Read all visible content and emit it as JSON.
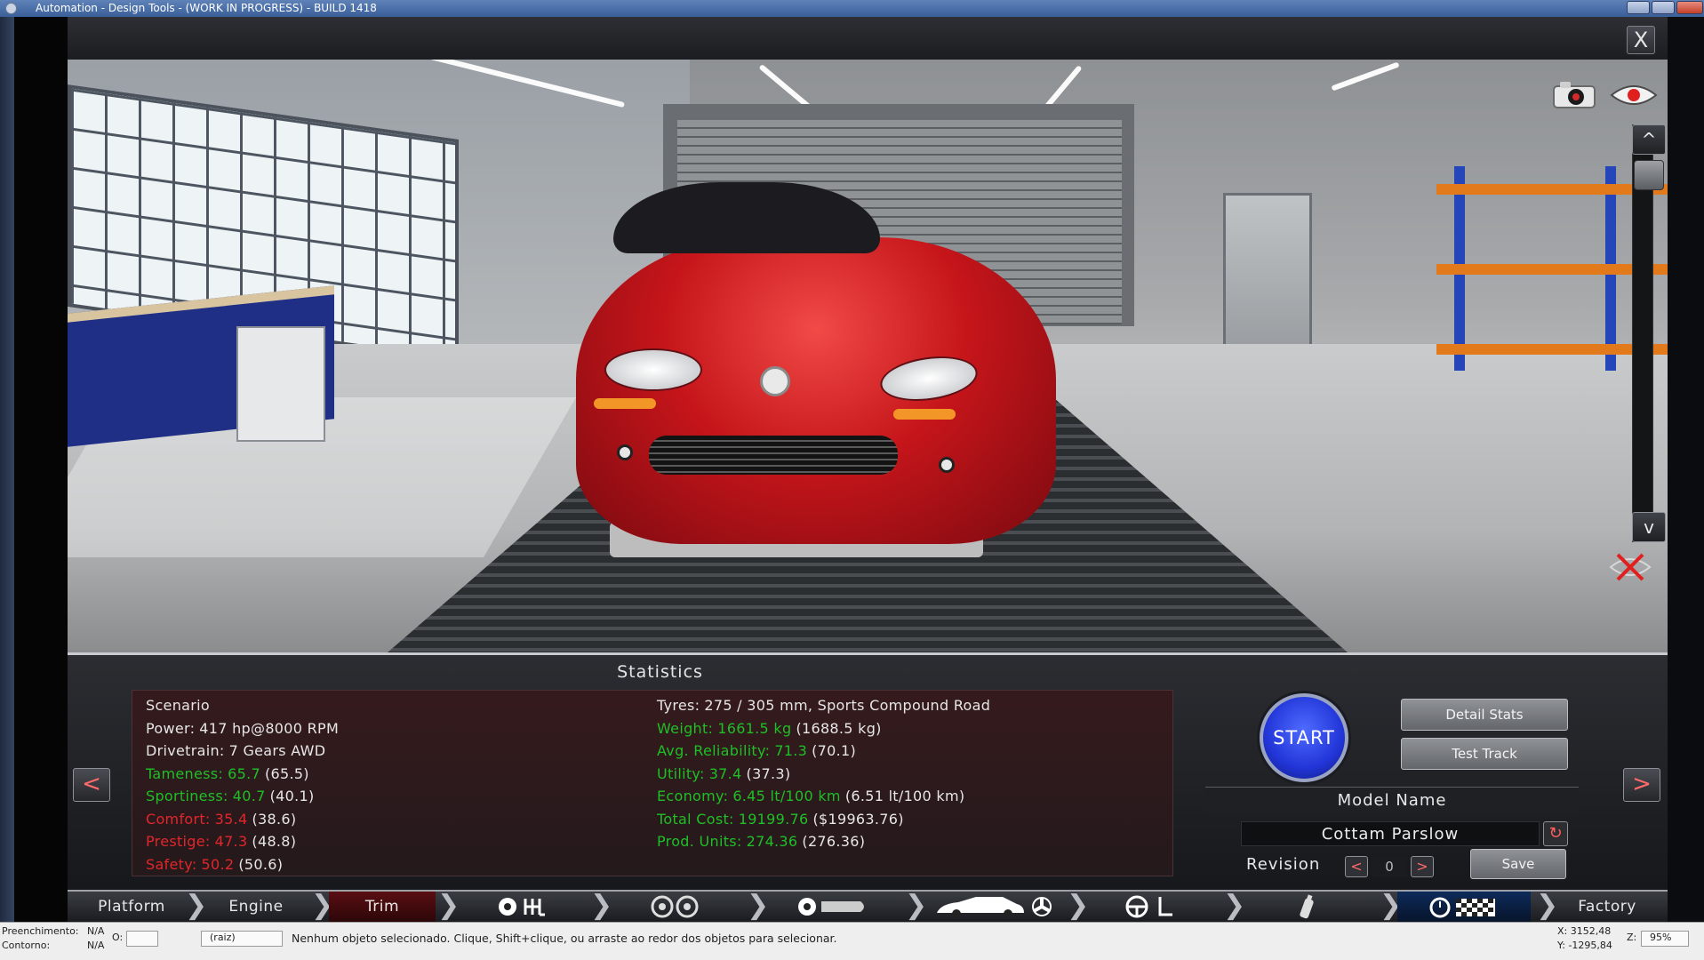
{
  "window": {
    "title": "Automation - Design Tools - (WORK IN PROGRESS) - BUILD 1418"
  },
  "viewport": {
    "close_label": "X",
    "scroll_up_label": "^",
    "scroll_down_label": "v"
  },
  "statistics": {
    "title": "Statistics",
    "left": [
      {
        "label": "Scenario",
        "value": "",
        "extra": "",
        "color": "#e6e6e6"
      },
      {
        "label": "Power:",
        "value": "417 hp@8000 RPM",
        "extra": "",
        "color": "#e6e6e6"
      },
      {
        "label": "Drivetrain:",
        "value": "7 Gears AWD",
        "extra": "",
        "color": "#e6e6e6"
      },
      {
        "label": "Tameness:",
        "value": "65.7",
        "extra": "(65.5)",
        "color": "#1fbf27"
      },
      {
        "label": "Sportiness:",
        "value": "40.7",
        "extra": "(40.1)",
        "color": "#1fbf27"
      },
      {
        "label": "Comfort:",
        "value": "35.4",
        "extra": "(38.6)",
        "color": "#e2262b"
      },
      {
        "label": "Prestige:",
        "value": "47.3",
        "extra": "(48.8)",
        "color": "#e2262b"
      },
      {
        "label": "Safety:",
        "value": "50.2",
        "extra": "(50.6)",
        "color": "#e2262b"
      }
    ],
    "right": [
      {
        "label": "Tyres:",
        "value": "275 / 305 mm, Sports Compound Road",
        "extra": "",
        "color": "#e6e6e6"
      },
      {
        "label": "Weight:",
        "value": "1661.5 kg",
        "extra": "(1688.5 kg)",
        "color": "#1fbf27"
      },
      {
        "label": "Avg. Reliability:",
        "value": "71.3",
        "extra": "(70.1)",
        "color": "#1fbf27"
      },
      {
        "label": "Utility:",
        "value": "37.4",
        "extra": "(37.3)",
        "color": "#1fbf27"
      },
      {
        "label": "Economy:",
        "value": "6.45 lt/100 km",
        "extra": "(6.51 lt/100 km)",
        "color": "#1fbf27"
      },
      {
        "label": "Total Cost:",
        "value": "19199.76",
        "extra": "($19963.76)",
        "color": "#1fbf27"
      },
      {
        "label": "Prod. Units:",
        "value": "274.36",
        "extra": "(276.36)",
        "color": "#1fbf27"
      }
    ]
  },
  "actions": {
    "start_label": "START",
    "detail_stats_label": "Detail Stats",
    "test_track_label": "Test Track",
    "model_name_heading": "Model Name",
    "model_name_value": "Cottam Parslow",
    "revision_label": "Revision",
    "revision_prev": "<",
    "revision_value": "0",
    "revision_next": ">",
    "save_label": "Save",
    "nav_prev": "<",
    "nav_next": ">"
  },
  "tabs": {
    "platform": "Platform",
    "engine": "Engine",
    "trim": "Trim",
    "factory": "Factory"
  },
  "statusbar": {
    "fill_label": "Preenchimento:",
    "fill_value": "N/A",
    "stroke_label": "Contorno:",
    "stroke_value": "N/A",
    "o_label": "O:",
    "layer_value": "(raiz)",
    "message": "Nenhum objeto selecionado. Clique, Shift+clique, ou arraste ao redor dos objetos para selecionar.",
    "x_readout": "X: 3152,48",
    "y_readout": "Y: -1295,84",
    "z_label": "Z:",
    "zoom_value": "95%"
  },
  "colors": {
    "accent_red": "#e2262b",
    "good_green": "#1fbf27",
    "start_blue": "#2235d8"
  }
}
